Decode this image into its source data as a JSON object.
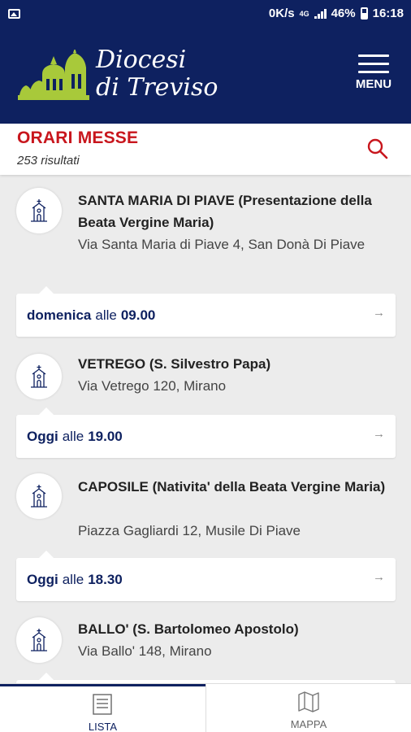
{
  "status_bar": {
    "speed": "0K/s",
    "network": "4G",
    "battery": "46%",
    "time": "16:18"
  },
  "header": {
    "logo_line1": "Diocesi",
    "logo_line2": "di Treviso",
    "menu_label": "MENU",
    "logo_icon": "cathedral-domes-logo",
    "menu_icon": "hamburger-icon"
  },
  "titlebar": {
    "title": "ORARI MESSE",
    "results": "253 risultati",
    "search_icon": "search-icon"
  },
  "colors": {
    "brand_navy": "#0e2160",
    "accent_red": "#c8161d",
    "logo_green": "#a8c93a",
    "background": "#ececec"
  },
  "entries": [
    {
      "name": "SANTA MARIA DI PIAVE (Presentazione della Beata Vergine Maria)",
      "address": "Via Santa Maria di Piave 4, San Donà Di Piave",
      "day": "domenica",
      "alle": "alle",
      "time": "09.00"
    },
    {
      "name": "VETREGO (S. Silvestro Papa)",
      "address": "Via Vetrego 120, Mirano",
      "day": "Oggi",
      "alle": "alle",
      "time": "19.00"
    },
    {
      "name": "CAPOSILE (Nativita' della Beata Vergine Maria)",
      "address": "Piazza Gagliardi 12, Musile Di Piave",
      "day": "Oggi",
      "alle": "alle",
      "time": "18.30"
    },
    {
      "name": "BALLO' (S. Bartolomeo Apostolo)",
      "address": "Via Ballo' 148, Mirano"
    }
  ],
  "bottom_nav": {
    "tabs": [
      {
        "label": "LISTA",
        "icon": "list-icon",
        "active": true
      },
      {
        "label": "MAPPA",
        "icon": "map-icon",
        "active": false
      }
    ]
  }
}
